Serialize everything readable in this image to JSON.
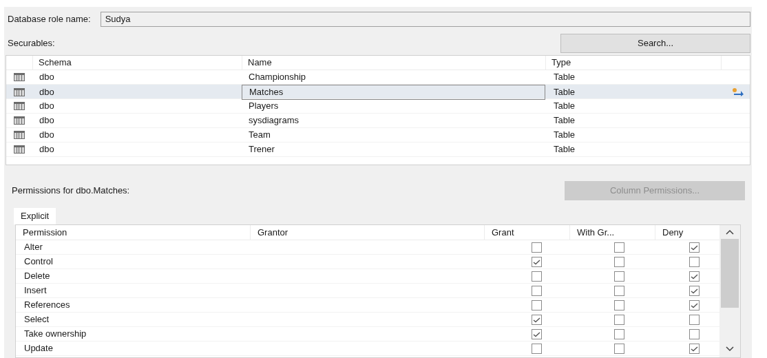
{
  "role_name": {
    "label": "Database role name:",
    "value": "Sudya"
  },
  "securables": {
    "label": "Securables:",
    "search_button": "Search...",
    "columns": [
      "Schema",
      "Name",
      "Type"
    ],
    "rows": [
      {
        "schema": "dbo",
        "name": "Championship",
        "type": "Table",
        "selected": false
      },
      {
        "schema": "dbo",
        "name": "Matches",
        "type": "Table",
        "selected": true
      },
      {
        "schema": "dbo",
        "name": "Players",
        "type": "Table",
        "selected": false
      },
      {
        "schema": "dbo",
        "name": "sysdiagrams",
        "type": "Table",
        "selected": false
      },
      {
        "schema": "dbo",
        "name": "Team",
        "type": "Table",
        "selected": false
      },
      {
        "schema": "dbo",
        "name": "Trener",
        "type": "Table",
        "selected": false
      }
    ]
  },
  "permissions": {
    "label": "Permissions for dbo.Matches:",
    "column_permissions_button": {
      "label": "Column Permissions...",
      "disabled": true
    },
    "tabs": [
      {
        "label": "Explicit",
        "selected": true
      }
    ],
    "columns": [
      "Permission",
      "Grantor",
      "Grant",
      "With Gr...",
      "Deny"
    ],
    "rows": [
      {
        "permission": "Alter",
        "grant": false,
        "with_grant": false,
        "deny": true
      },
      {
        "permission": "Control",
        "grant": true,
        "with_grant": false,
        "deny": false
      },
      {
        "permission": "Delete",
        "grant": false,
        "with_grant": false,
        "deny": true
      },
      {
        "permission": "Insert",
        "grant": false,
        "with_grant": false,
        "deny": true
      },
      {
        "permission": "References",
        "grant": false,
        "with_grant": false,
        "deny": true
      },
      {
        "permission": "Select",
        "grant": true,
        "with_grant": false,
        "deny": false
      },
      {
        "permission": "Take ownership",
        "grant": true,
        "with_grant": false,
        "deny": false
      },
      {
        "permission": "Update",
        "grant": false,
        "with_grant": false,
        "deny": true
      }
    ]
  }
}
